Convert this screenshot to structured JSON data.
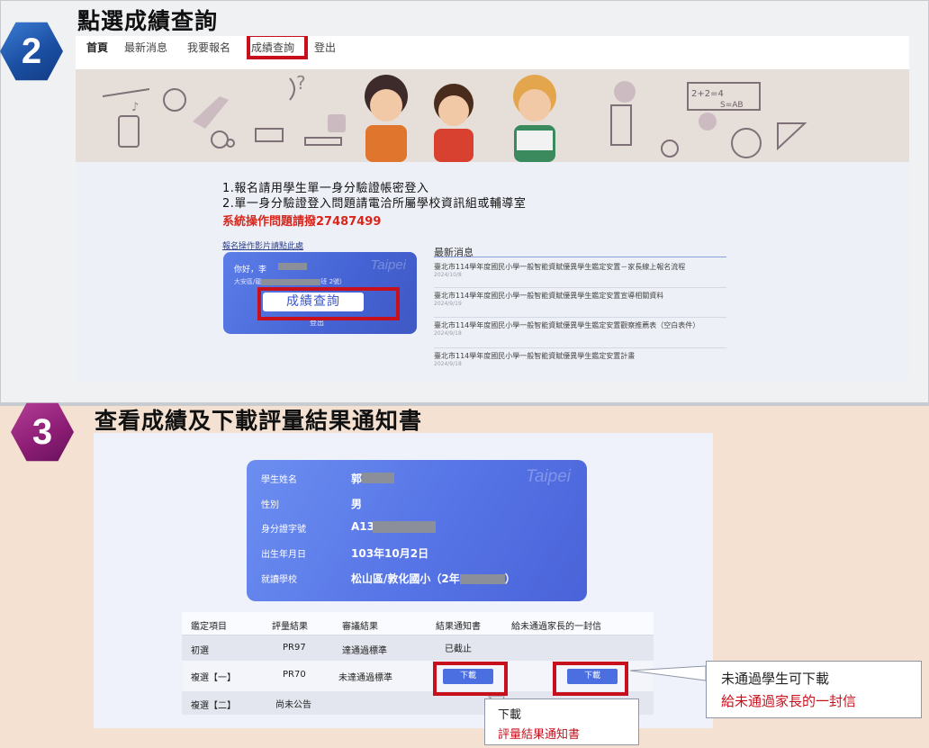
{
  "step2": {
    "number": "2",
    "title": "點選成績查詢",
    "nav": [
      "首頁",
      "最新消息",
      "我要報名",
      "成績查詢",
      "登出"
    ],
    "notices": [
      "1.報名請用學生單一身分驗證帳密登入",
      "2.單一身分驗證登入問題請電洽所屬學校資訊組或輔導室"
    ],
    "hotline": "系統操作問題請撥27487499",
    "video_link": "報名操作影片請點此處",
    "user_card": {
      "watermark": "Taipei",
      "greeting": "你好，李",
      "school_prefix": "大安區/龍",
      "school_suffix": "班 2號）",
      "grade_query_button": "成績查詢",
      "logout": "登出"
    },
    "news": {
      "heading": "最新消息",
      "items": [
        {
          "title": "臺北市114學年度國民小學一般智能資賦優異學生鑑定安置－家長線上報名流程",
          "date": "2024/10/8"
        },
        {
          "title": "臺北市114學年度國民小學一般智能資賦優異學生鑑定安置宣導相關資料",
          "date": "2024/9/19"
        },
        {
          "title": "臺北市114學年度國民小學一般智能資賦優異學生鑑定安置觀察推薦表（空白表件）",
          "date": "2024/9/18"
        },
        {
          "title": "臺北市114學年度國民小學一般智能資賦優異學生鑑定安置計畫",
          "date": "2024/9/18"
        }
      ]
    }
  },
  "step3": {
    "number": "3",
    "title": "查看成績及下載評量結果通知書",
    "student_card": {
      "watermark": "Taipei",
      "fields": [
        {
          "label": "學生姓名",
          "value": "郭"
        },
        {
          "label": "性別",
          "value": "男"
        },
        {
          "label": "身分證字號",
          "value": "A13"
        },
        {
          "label": "出生年月日",
          "value": "103年10月2日"
        },
        {
          "label": "就讀學校",
          "value": "松山區/敦化國小（2年"
        }
      ],
      "school_close": "）"
    },
    "table": {
      "headers": [
        "鑑定項目",
        "評量結果",
        "審議結果",
        "結果通知書",
        "給未通過家長的一封信"
      ],
      "rows": [
        {
          "item": "初選",
          "result": "PR97",
          "review": "達通過標準",
          "notice": "已截止",
          "letter": ""
        },
        {
          "item": "複選【一】",
          "result": "PR70",
          "review": "未達通過標準",
          "notice": "下載",
          "letter": "下載"
        },
        {
          "item": "複選【二】",
          "result": "尚未公告",
          "review": "",
          "notice": "",
          "letter": ""
        }
      ]
    },
    "callout_notice": {
      "line1": "下載",
      "line2": "評量結果通知書"
    },
    "callout_letter": {
      "line1": "未通過學生可下載",
      "line2": "給未通過家長的一封信"
    }
  },
  "colors": {
    "highlight_red": "#c8101c",
    "card_blue": "#5674e6",
    "step2_badge": "#1b4fa3",
    "step3_badge": "#8e1e75",
    "step3_bg": "#f4e1d2"
  }
}
